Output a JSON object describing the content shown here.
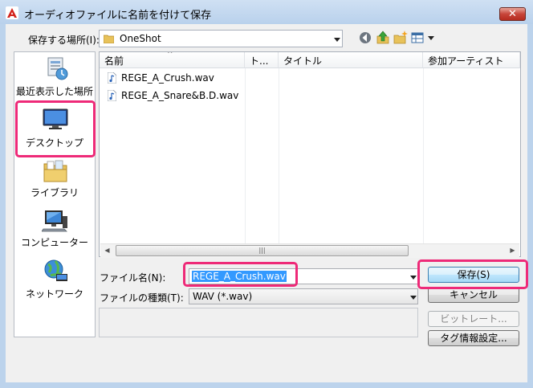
{
  "window": {
    "title": "オーディオファイルに名前を付けて保存",
    "close_label": "✕"
  },
  "location": {
    "label": "保存する場所(I):",
    "value": "OneShot"
  },
  "toolbar": {
    "icons": [
      "back-icon",
      "up-folder-icon",
      "new-folder-icon",
      "view-menu-icon"
    ]
  },
  "places": [
    {
      "label": "最近表示した場所",
      "icon": "recent-places-icon"
    },
    {
      "label": "デスクトップ",
      "icon": "desktop-icon"
    },
    {
      "label": "ライブラリ",
      "icon": "libraries-icon"
    },
    {
      "label": "コンピューター",
      "icon": "computer-icon"
    },
    {
      "label": "ネットワーク",
      "icon": "network-icon"
    }
  ],
  "columns": [
    "名前",
    "ト...",
    "タイトル",
    "参加アーティスト"
  ],
  "files": [
    "REGE_A_Crush.wav",
    "REGE_A_Snare&B.D.wav"
  ],
  "filename": {
    "label": "ファイル名(N):",
    "value": "REGE_A_Crush.wav"
  },
  "filetype": {
    "label": "ファイルの種類(T):",
    "value": "WAV (*.wav)"
  },
  "buttons": {
    "save": "保存(S)",
    "cancel": "キャンセル",
    "bitrate": "ビットレート...",
    "tag_settings": "タグ情報設定..."
  },
  "scrollbar": {
    "left_arrow": "◀",
    "right_arrow": "▶",
    "thumb_grip": "|||"
  },
  "colors": {
    "highlight": "#ee2a78",
    "selection": "#3399ff",
    "title_bar": "#c3d7ee"
  }
}
